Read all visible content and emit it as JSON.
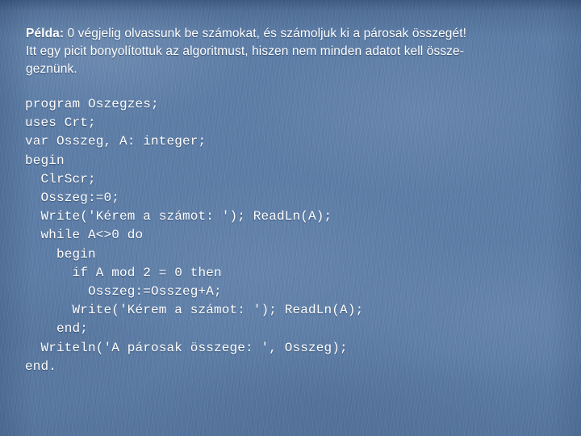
{
  "slide": {
    "background_color": "#5b7ca6",
    "text_color": "#ffffff"
  },
  "intro": {
    "lead_label": "Példa:",
    "line1_rest": " 0 végjelig olvassunk be számokat, és számoljuk ki a párosak összegét!",
    "line2": "Itt egy picit bonyolítottuk az algoritmust, hiszen nem minden adatot kell össze-",
    "line3": "geznünk."
  },
  "code": {
    "language": "pascal",
    "lines": [
      "program Oszegzes;",
      "uses Crt;",
      "var Osszeg, A: integer;",
      "begin",
      "  ClrScr;",
      "  Osszeg:=0;",
      "  Write('Kérem a számot: '); ReadLn(A);",
      "  while A<>0 do",
      "    begin",
      "      if A mod 2 = 0 then",
      "        Osszeg:=Osszeg+A;",
      "      Write('Kérem a számot: '); ReadLn(A);",
      "    end;",
      "  Writeln('A párosak összege: ', Osszeg);",
      "end."
    ]
  }
}
